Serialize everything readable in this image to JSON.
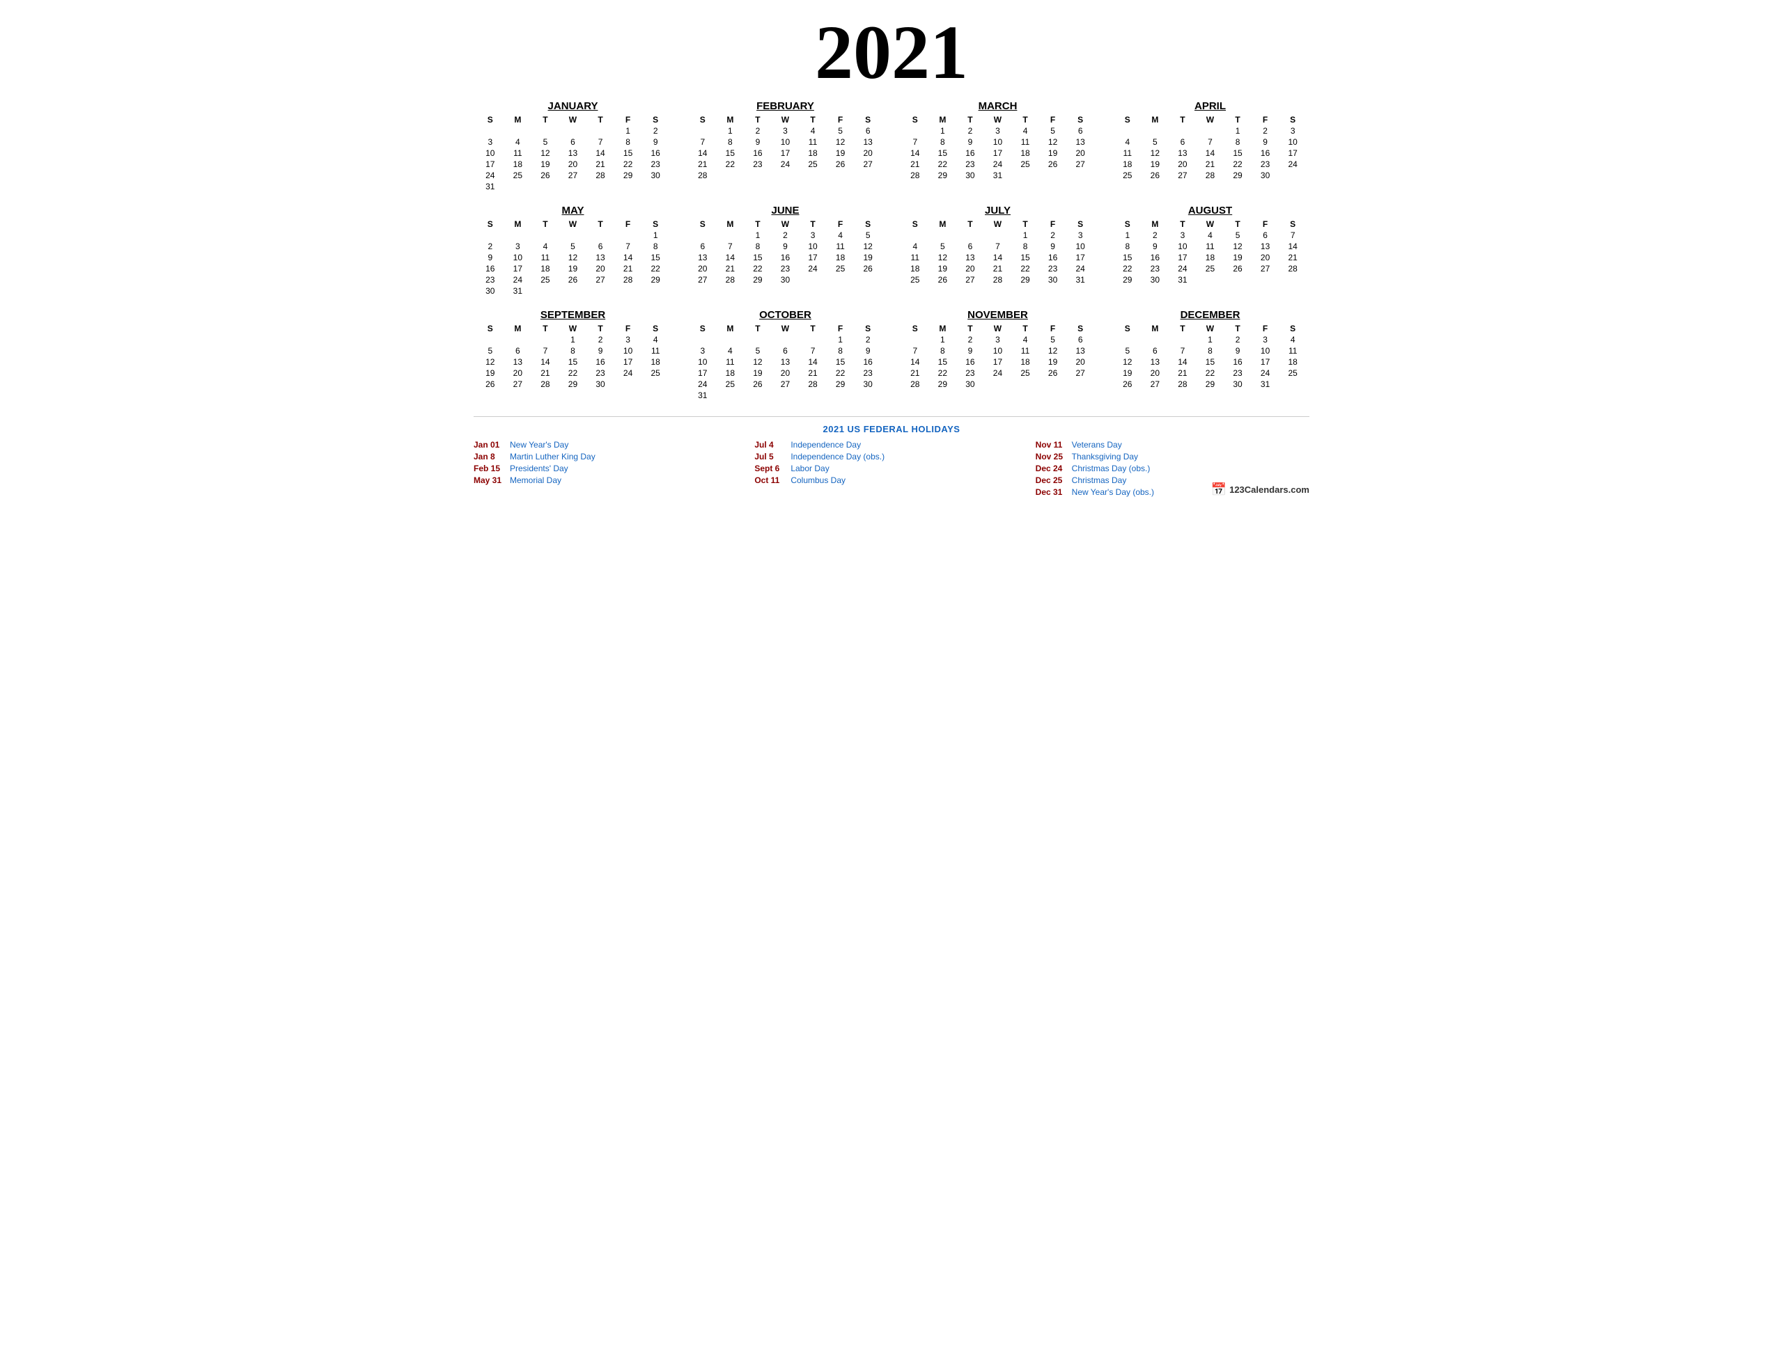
{
  "year": "2021",
  "months": [
    {
      "name": "JANUARY",
      "days_header": [
        "S",
        "M",
        "T",
        "W",
        "T",
        "F",
        "S"
      ],
      "weeks": [
        [
          "",
          "",
          "",
          "",
          "",
          "1",
          "2"
        ],
        [
          "3",
          "4",
          "5",
          "6",
          "7",
          "8",
          "9"
        ],
        [
          "10",
          "11",
          "12",
          "13",
          "14",
          "15",
          "16"
        ],
        [
          "17",
          "18",
          "19",
          "20",
          "21",
          "22",
          "23"
        ],
        [
          "24",
          "25",
          "26",
          "27",
          "28",
          "29",
          "30"
        ],
        [
          "31",
          "",
          "",
          "",
          "",
          "",
          ""
        ]
      ]
    },
    {
      "name": "FEBRUARY",
      "days_header": [
        "S",
        "M",
        "T",
        "W",
        "T",
        "F",
        "S"
      ],
      "weeks": [
        [
          "",
          "1",
          "2",
          "3",
          "4",
          "5",
          "6"
        ],
        [
          "7",
          "8",
          "9",
          "10",
          "11",
          "12",
          "13"
        ],
        [
          "14",
          "15",
          "16",
          "17",
          "18",
          "19",
          "20"
        ],
        [
          "21",
          "22",
          "23",
          "24",
          "25",
          "26",
          "27"
        ],
        [
          "28",
          "",
          "",
          "",
          "",
          "",
          ""
        ]
      ]
    },
    {
      "name": "MARCH",
      "days_header": [
        "S",
        "M",
        "T",
        "W",
        "T",
        "F",
        "S"
      ],
      "weeks": [
        [
          "",
          "1",
          "2",
          "3",
          "4",
          "5",
          "6"
        ],
        [
          "7",
          "8",
          "9",
          "10",
          "11",
          "12",
          "13"
        ],
        [
          "14",
          "15",
          "16",
          "17",
          "18",
          "19",
          "20"
        ],
        [
          "21",
          "22",
          "23",
          "24",
          "25",
          "26",
          "27"
        ],
        [
          "28",
          "29",
          "30",
          "31",
          "",
          "",
          ""
        ]
      ]
    },
    {
      "name": "APRIL",
      "days_header": [
        "S",
        "M",
        "T",
        "W",
        "T",
        "F",
        "S"
      ],
      "weeks": [
        [
          "",
          "",
          "",
          "",
          "1",
          "2",
          "3"
        ],
        [
          "4",
          "5",
          "6",
          "7",
          "8",
          "9",
          "10"
        ],
        [
          "11",
          "12",
          "13",
          "14",
          "15",
          "16",
          "17"
        ],
        [
          "18",
          "19",
          "20",
          "21",
          "22",
          "23",
          "24"
        ],
        [
          "25",
          "26",
          "27",
          "28",
          "29",
          "30",
          ""
        ]
      ]
    },
    {
      "name": "MAY",
      "days_header": [
        "S",
        "M",
        "T",
        "W",
        "T",
        "F",
        "S"
      ],
      "weeks": [
        [
          "",
          "",
          "",
          "",
          "",
          "",
          "1"
        ],
        [
          "2",
          "3",
          "4",
          "5",
          "6",
          "7",
          "8"
        ],
        [
          "9",
          "10",
          "11",
          "12",
          "13",
          "14",
          "15"
        ],
        [
          "16",
          "17",
          "18",
          "19",
          "20",
          "21",
          "22"
        ],
        [
          "23",
          "24",
          "25",
          "26",
          "27",
          "28",
          "29"
        ],
        [
          "30",
          "31",
          "",
          "",
          "",
          "",
          ""
        ]
      ]
    },
    {
      "name": "JUNE",
      "days_header": [
        "S",
        "M",
        "T",
        "W",
        "T",
        "F",
        "S"
      ],
      "weeks": [
        [
          "",
          "",
          "1",
          "2",
          "3",
          "4",
          "5"
        ],
        [
          "6",
          "7",
          "8",
          "9",
          "10",
          "11",
          "12"
        ],
        [
          "13",
          "14",
          "15",
          "16",
          "17",
          "18",
          "19"
        ],
        [
          "20",
          "21",
          "22",
          "23",
          "24",
          "25",
          "26"
        ],
        [
          "27",
          "28",
          "29",
          "30",
          "",
          "",
          ""
        ]
      ]
    },
    {
      "name": "JULY",
      "days_header": [
        "S",
        "M",
        "T",
        "W",
        "T",
        "F",
        "S"
      ],
      "weeks": [
        [
          "",
          "",
          "",
          "",
          "1",
          "2",
          "3"
        ],
        [
          "4",
          "5",
          "6",
          "7",
          "8",
          "9",
          "10"
        ],
        [
          "11",
          "12",
          "13",
          "14",
          "15",
          "16",
          "17"
        ],
        [
          "18",
          "19",
          "20",
          "21",
          "22",
          "23",
          "24"
        ],
        [
          "25",
          "26",
          "27",
          "28",
          "29",
          "30",
          "31"
        ]
      ]
    },
    {
      "name": "AUGUST",
      "days_header": [
        "S",
        "M",
        "T",
        "W",
        "T",
        "F",
        "S"
      ],
      "weeks": [
        [
          "1",
          "2",
          "3",
          "4",
          "5",
          "6",
          "7"
        ],
        [
          "8",
          "9",
          "10",
          "11",
          "12",
          "13",
          "14"
        ],
        [
          "15",
          "16",
          "17",
          "18",
          "19",
          "20",
          "21"
        ],
        [
          "22",
          "23",
          "24",
          "25",
          "26",
          "27",
          "28"
        ],
        [
          "29",
          "30",
          "31",
          "",
          "",
          "",
          ""
        ]
      ]
    },
    {
      "name": "SEPTEMBER",
      "days_header": [
        "S",
        "M",
        "T",
        "W",
        "T",
        "F",
        "S"
      ],
      "weeks": [
        [
          "",
          "",
          "",
          "1",
          "2",
          "3",
          "4"
        ],
        [
          "5",
          "6",
          "7",
          "8",
          "9",
          "10",
          "11"
        ],
        [
          "12",
          "13",
          "14",
          "15",
          "16",
          "17",
          "18"
        ],
        [
          "19",
          "20",
          "21",
          "22",
          "23",
          "24",
          "25"
        ],
        [
          "26",
          "27",
          "28",
          "29",
          "30",
          "",
          ""
        ]
      ]
    },
    {
      "name": "OCTOBER",
      "days_header": [
        "S",
        "M",
        "T",
        "W",
        "T",
        "F",
        "S"
      ],
      "weeks": [
        [
          "",
          "",
          "",
          "",
          "",
          "1",
          "2"
        ],
        [
          "3",
          "4",
          "5",
          "6",
          "7",
          "8",
          "9"
        ],
        [
          "10",
          "11",
          "12",
          "13",
          "14",
          "15",
          "16"
        ],
        [
          "17",
          "18",
          "19",
          "20",
          "21",
          "22",
          "23"
        ],
        [
          "24",
          "25",
          "26",
          "27",
          "28",
          "29",
          "30"
        ],
        [
          "31",
          "",
          "",
          "",
          "",
          "",
          ""
        ]
      ]
    },
    {
      "name": "NOVEMBER",
      "days_header": [
        "S",
        "M",
        "T",
        "W",
        "T",
        "F",
        "S"
      ],
      "weeks": [
        [
          "",
          "1",
          "2",
          "3",
          "4",
          "5",
          "6"
        ],
        [
          "7",
          "8",
          "9",
          "10",
          "11",
          "12",
          "13"
        ],
        [
          "14",
          "15",
          "16",
          "17",
          "18",
          "19",
          "20"
        ],
        [
          "21",
          "22",
          "23",
          "24",
          "25",
          "26",
          "27"
        ],
        [
          "28",
          "29",
          "30",
          "",
          "",
          "",
          ""
        ]
      ]
    },
    {
      "name": "DECEMBER",
      "days_header": [
        "S",
        "M",
        "T",
        "W",
        "T",
        "F",
        "S"
      ],
      "weeks": [
        [
          "",
          "",
          "",
          "1",
          "2",
          "3",
          "4"
        ],
        [
          "5",
          "6",
          "7",
          "8",
          "9",
          "10",
          "11"
        ],
        [
          "12",
          "13",
          "14",
          "15",
          "16",
          "17",
          "18"
        ],
        [
          "19",
          "20",
          "21",
          "22",
          "23",
          "24",
          "25"
        ],
        [
          "26",
          "27",
          "28",
          "29",
          "30",
          "31",
          ""
        ]
      ]
    }
  ],
  "holidays_title": "2021 US FEDERAL HOLIDAYS",
  "holidays_col1": [
    {
      "date": "Jan 01",
      "name": "New Year's Day"
    },
    {
      "date": "Jan 8",
      "name": "Martin Luther King Day"
    },
    {
      "date": "Feb 15",
      "name": "Presidents' Day"
    },
    {
      "date": "May 31",
      "name": "Memorial Day"
    }
  ],
  "holidays_col2": [
    {
      "date": "Jul 4",
      "name": "Independence Day"
    },
    {
      "date": "Jul 5",
      "name": "Independence Day (obs.)"
    },
    {
      "date": "Sept 6",
      "name": "Labor Day"
    },
    {
      "date": "Oct 11",
      "name": "Columbus Day"
    }
  ],
  "holidays_col3": [
    {
      "date": "Nov 11",
      "name": "Veterans Day"
    },
    {
      "date": "Nov 25",
      "name": "Thanksgiving Day"
    },
    {
      "date": "Dec 24",
      "name": "Christmas Day (obs.)"
    },
    {
      "date": "Dec 25",
      "name": "Christmas Day"
    },
    {
      "date": "Dec 31",
      "name": "New Year's Day (obs.)"
    }
  ],
  "branding": "123Calendars.com"
}
